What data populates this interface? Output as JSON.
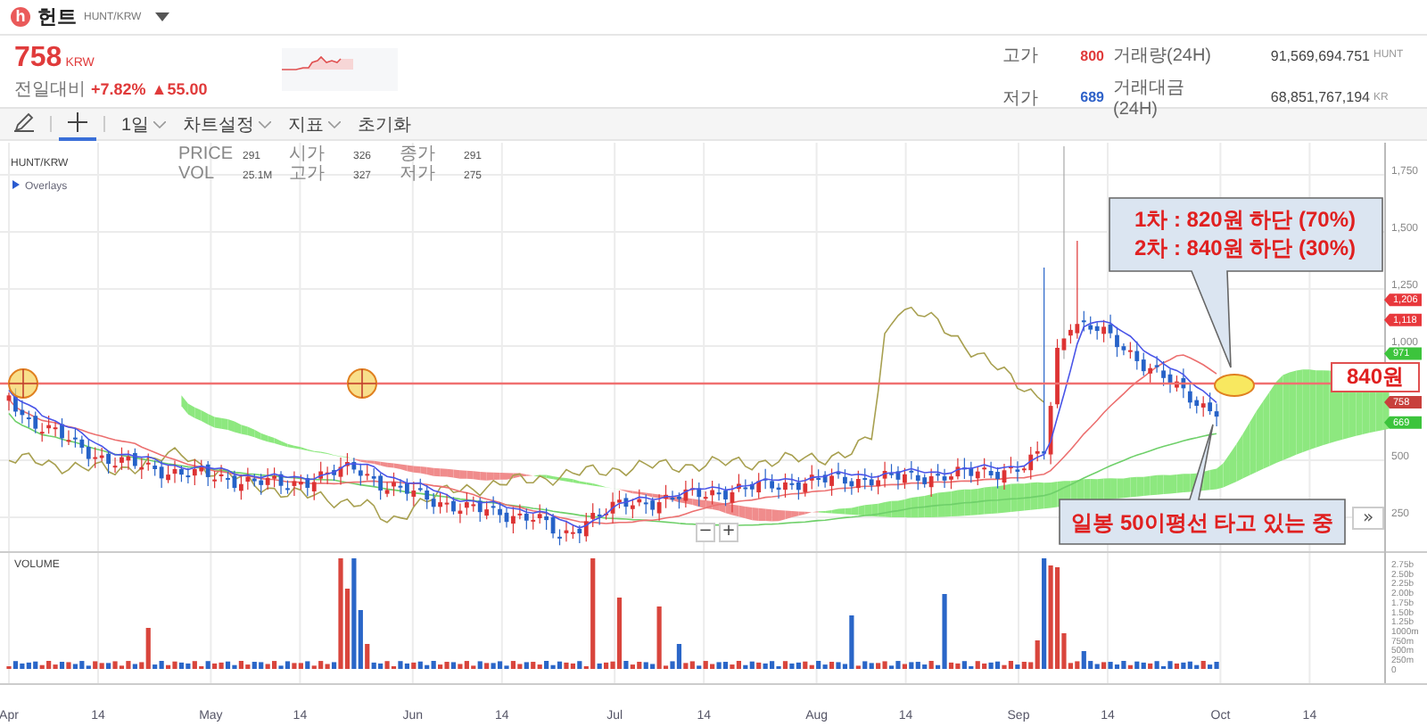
{
  "header": {
    "logo_letter": "h",
    "name": "헌트",
    "pair": "HUNT/KRW"
  },
  "price": {
    "value": "758",
    "unit": "KRW",
    "change_label": "전일대비",
    "change_pct": "+7.82%",
    "change_abs": "▲55.00"
  },
  "stats": [
    {
      "label": "고가",
      "value": "800",
      "color": "#e03b3b",
      "volume_label": "거래량(24H)",
      "volume_value": "91,569,694.751",
      "volume_unit": "HUNT"
    },
    {
      "label": "저가",
      "value": "689",
      "color": "#2f62c9",
      "volume_label": "거래대금(24H)",
      "volume_value": "68,851,767,194",
      "volume_unit": "KR"
    }
  ],
  "toolbar": {
    "tools": [
      {
        "kind": "pencil",
        "selected": false
      },
      {
        "kind": "crosshair",
        "selected": true
      }
    ],
    "menus": [
      {
        "label": "1일",
        "dropdown": true
      },
      {
        "label": "차트설정",
        "dropdown": true
      },
      {
        "label": "지표",
        "dropdown": true
      },
      {
        "label": "초기화",
        "dropdown": false
      }
    ]
  },
  "chart": {
    "symbol": "HUNT/KRW",
    "legend": [
      [
        {
          "label": "PRICE",
          "value": "291"
        },
        {
          "label": "시가",
          "value": "326"
        },
        {
          "label": "종가",
          "value": "291"
        }
      ],
      [
        {
          "label": "VOL",
          "value": "25.1M"
        },
        {
          "label": "고가",
          "value": "327"
        },
        {
          "label": "저가",
          "value": "275"
        }
      ]
    ],
    "overlays_label": "Overlays",
    "y_ticks": [
      "1,750",
      "1,500",
      "1,250",
      "1,000",
      "500",
      "250"
    ],
    "price_tags": [
      {
        "text": "1,206",
        "color": "#e8383c"
      },
      {
        "text": "1,118",
        "color": "#e8383c"
      },
      {
        "text": "971",
        "color": "#3cc43c"
      },
      {
        "text": "758",
        "color": "#c8403c"
      },
      {
        "text": "669",
        "color": "#3cc43c"
      }
    ],
    "callout_lines": [
      "1차 : 820원 하단 (70%)",
      "2차 : 840원 하단 (30%)"
    ],
    "level_label": "840원",
    "note": "일봉 50이평선 타고 있는 중",
    "zoom_buttons": [
      "−",
      "+"
    ],
    "scroll_button": "»",
    "volume": {
      "label": "VOLUME",
      "y_ticks": [
        "2.75b",
        "2.50b",
        "2.25b",
        "2.00b",
        "1.75b",
        "1.50b",
        "1.25b",
        "1000m",
        "750m",
        "500m",
        "250m",
        "0"
      ]
    },
    "x_ticks": [
      "Apr",
      "14",
      "May",
      "14",
      "Jun",
      "14",
      "Jul",
      "14",
      "Aug",
      "14",
      "Sep",
      "14",
      "Oct",
      "14"
    ]
  }
}
